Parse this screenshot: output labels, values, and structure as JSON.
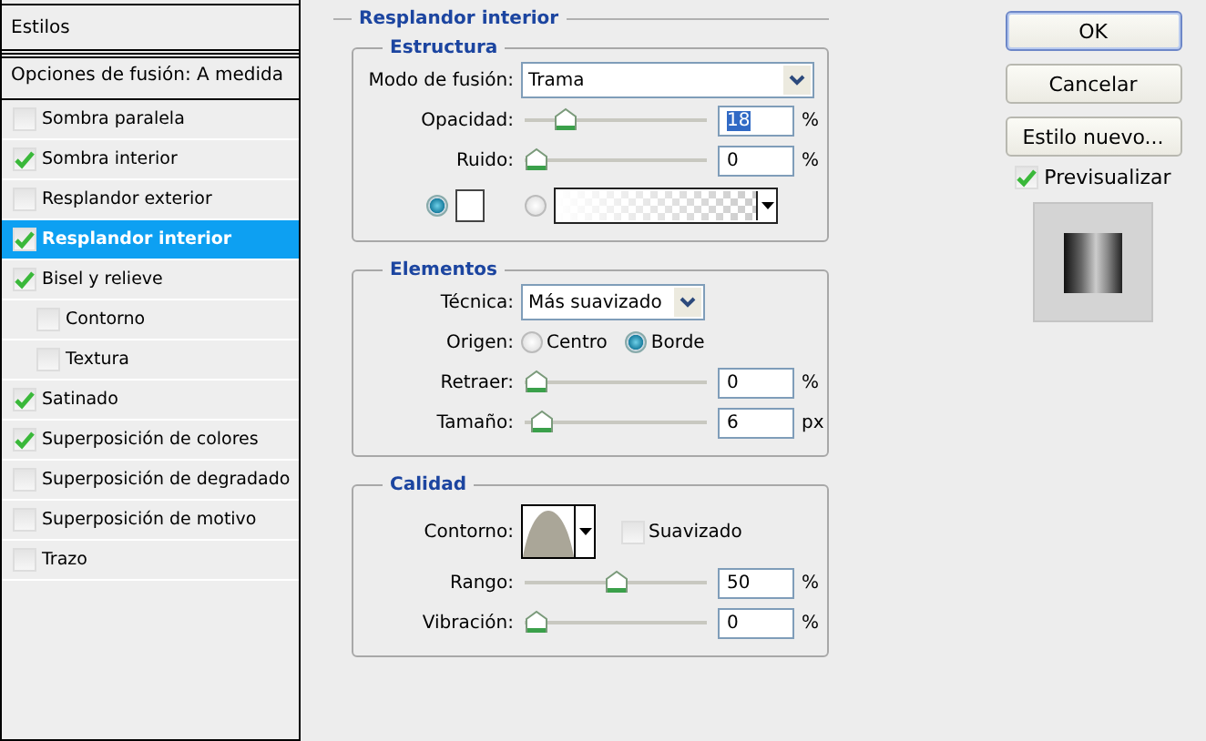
{
  "sidebar": {
    "header": "Estilos",
    "blending_options": "Opciones de fusión: A medida",
    "items": [
      {
        "label": "Sombra paralela",
        "checked": false,
        "selected": false
      },
      {
        "label": "Sombra interior",
        "checked": true,
        "selected": false
      },
      {
        "label": "Resplandor exterior",
        "checked": false,
        "selected": false
      },
      {
        "label": "Resplandor interior",
        "checked": true,
        "selected": true
      },
      {
        "label": "Bisel y relieve",
        "checked": true,
        "selected": false,
        "children": [
          {
            "label": "Contorno",
            "checked": false,
            "selected": false
          },
          {
            "label": "Textura",
            "checked": false,
            "selected": false
          }
        ]
      },
      {
        "label": "Satinado",
        "checked": true,
        "selected": false
      },
      {
        "label": "Superposición de colores",
        "checked": true,
        "selected": false
      },
      {
        "label": "Superposición de degradado",
        "checked": false,
        "selected": false
      },
      {
        "label": "Superposición de motivo",
        "checked": false,
        "selected": false
      },
      {
        "label": "Trazo",
        "checked": false,
        "selected": false
      }
    ]
  },
  "panel": {
    "title": "Resplandor interior",
    "groups": [
      {
        "title": "Estructura",
        "rows": [
          {
            "kind": "dropdown",
            "label": "Modo de fusión:",
            "value": "Trama"
          },
          {
            "kind": "slider",
            "label": "Opacidad:",
            "level": 0.18,
            "value": "18",
            "unit": "%",
            "highlighted": true
          },
          {
            "kind": "slider",
            "label": "Ruido:",
            "level": 0,
            "value": "0",
            "unit": "%",
            "highlighted": false
          },
          {
            "kind": "fill",
            "options": [
              {
                "selected": true
              },
              {
                "selected": false
              }
            ]
          }
        ]
      },
      {
        "title": "Elementos",
        "rows": [
          {
            "kind": "dropdown",
            "label": "Técnica:",
            "value": "Más suavizado"
          },
          {
            "kind": "radios",
            "label": "Origen:",
            "options": [
              {
                "label": "Centro",
                "selected": false
              },
              {
                "label": "Borde",
                "selected": true
              }
            ]
          },
          {
            "kind": "slider",
            "label": "Retraer:",
            "level": 0,
            "value": "0",
            "unit": "%",
            "highlighted": false
          },
          {
            "kind": "slider",
            "label": "Tamaño:",
            "level": 0.03,
            "value": "6",
            "unit": "px",
            "highlighted": false
          }
        ]
      },
      {
        "title": "Calidad",
        "rows": [
          {
            "kind": "contour",
            "label": "Contorno:",
            "check_label": "Suavizado",
            "checked": false
          },
          {
            "kind": "slider",
            "label": "Rango:",
            "level": 0.5,
            "value": "50",
            "unit": "%",
            "highlighted": false
          },
          {
            "kind": "slider",
            "label": "Vibración:",
            "level": 0,
            "value": "0",
            "unit": "%",
            "highlighted": false
          }
        ]
      }
    ]
  },
  "buttons": [
    {
      "label": "OK",
      "default": true
    },
    {
      "label": "Cancelar",
      "default": false
    },
    {
      "label": "Estilo nuevo...",
      "default": false
    }
  ],
  "preview": {
    "label": "Previsualizar",
    "checked": true
  }
}
